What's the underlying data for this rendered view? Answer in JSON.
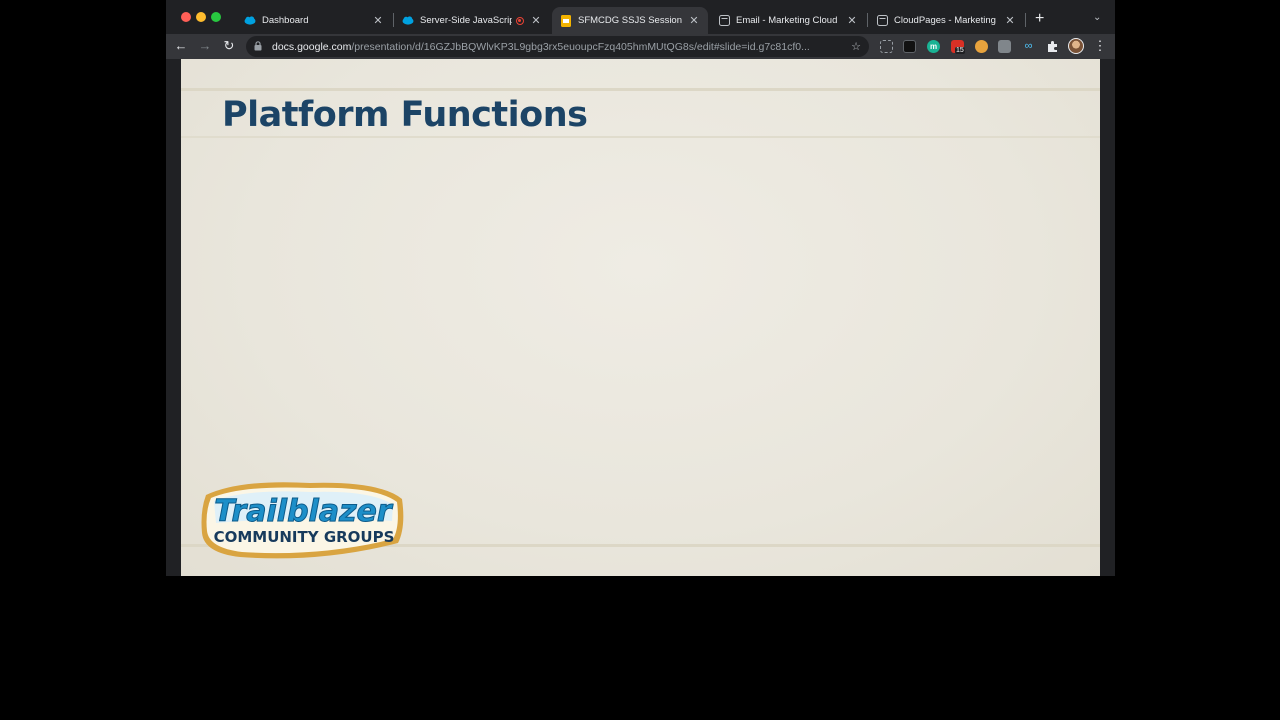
{
  "browser": {
    "tabs": [
      {
        "title": "Dashboard",
        "favicon": "salesforce-cloud-icon",
        "active": false
      },
      {
        "title": "Server-Side JavaScrip",
        "favicon": "salesforce-cloud-icon",
        "active": false,
        "recording": true
      },
      {
        "title": "SFMCDG SSJS Session O",
        "favicon": "google-slides-icon",
        "active": true
      },
      {
        "title": "Email - Marketing Cloud",
        "favicon": "page-icon",
        "active": false
      },
      {
        "title": "CloudPages - Marketing C",
        "favicon": "page-icon",
        "active": false
      }
    ],
    "address": {
      "host": "docs.google.com",
      "path": "/presentation/d/16GZJbBQWlvKP3L9gbg3rx5euoupcFzq405hmMUtQG8s/edit#slide=id.g7c81cf0..."
    },
    "extensions_badge": "15",
    "colors": {
      "frame": "#202124",
      "toolbar": "#35363a",
      "salesforce": "#00a1e0",
      "slides": "#f4b400",
      "recording": "#ea4335"
    }
  },
  "slide": {
    "title": "Platform Functions",
    "logo": {
      "line1": "Trailblazer",
      "line2": "COMMUNITY GROUPS"
    },
    "colors": {
      "title": "#1c4466",
      "logo_blue": "#1d8fc9"
    }
  }
}
